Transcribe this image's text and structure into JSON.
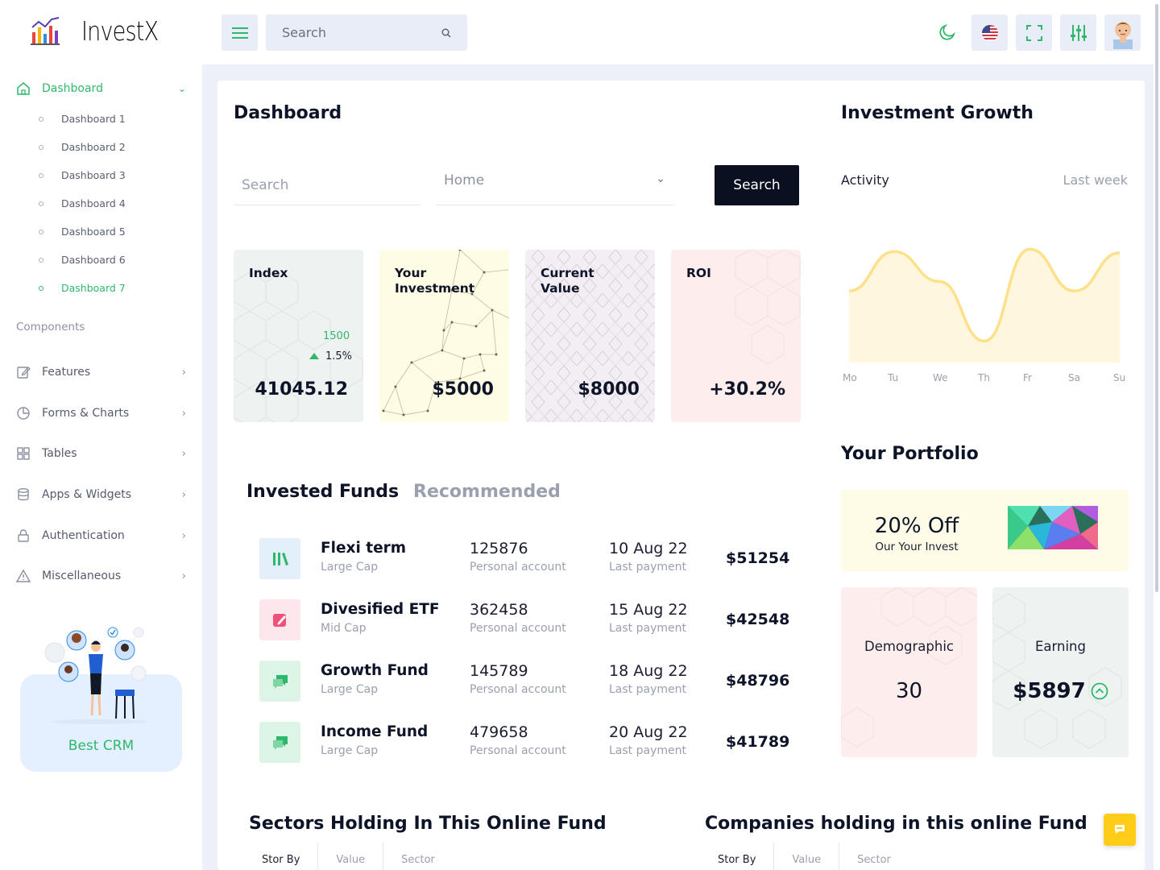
{
  "brand": {
    "name": "InvestX"
  },
  "sidebar": {
    "dashboard_label": "Dashboard",
    "sub_items": [
      "Dashboard 1",
      "Dashboard 2",
      "Dashboard 3",
      "Dashboard 4",
      "Dashboard 5",
      "Dashboard 6",
      "Dashboard 7"
    ],
    "active_sub_item": "Dashboard 7",
    "components_heading": "Components",
    "groups": [
      {
        "label": "Features",
        "icon": "edit-icon"
      },
      {
        "label": "Forms & Charts",
        "icon": "pie-chart-icon"
      },
      {
        "label": "Tables",
        "icon": "grid-icon"
      },
      {
        "label": "Apps & Widgets",
        "icon": "database-icon"
      },
      {
        "label": "Authentication",
        "icon": "lock-icon"
      },
      {
        "label": "Miscellaneous",
        "icon": "alert-triangle-icon"
      }
    ],
    "promo_label": "Best CRM"
  },
  "topbar": {
    "search_placeholder": "Search",
    "icons": [
      "menu-icon",
      "search-icon",
      "moon-icon",
      "us-flag-icon",
      "fullscreen-icon",
      "settings-sliders-icon",
      "user-avatar"
    ]
  },
  "dashboard": {
    "title": "Dashboard",
    "filter_search_placeholder": "Search",
    "filter_select_value": "Home",
    "filter_button": "Search",
    "stats": [
      {
        "label": "Index",
        "value": "41045.12",
        "extra_value": "1500",
        "change": "1.5%",
        "color": "#eef2f1"
      },
      {
        "label": "Your Investment",
        "value": "$5000",
        "color": "#fefce4"
      },
      {
        "label": "Current Value",
        "value": "$8000",
        "color": "#f2eef4"
      },
      {
        "label": "ROI",
        "value": "+30.2%",
        "color": "#fdeeed"
      }
    ],
    "tabs": [
      "Invested Funds",
      "Recommended"
    ],
    "funds": [
      {
        "name": "Flexi term",
        "category": "Large Cap",
        "account_no": "125876",
        "account_type": "Personal account",
        "date": "10 Aug 22",
        "date_label": "Last payment",
        "amount": "$51254",
        "icon": "library-icon",
        "icon_bg": "#e4effc",
        "icon_color": "#2fb86c"
      },
      {
        "name": "Divesified ETF",
        "category": "Mid Cap",
        "account_no": "362458",
        "account_type": "Personal account",
        "date": "15 Aug 22",
        "date_label": "Last payment",
        "amount": "$42548",
        "icon": "edit-box-icon",
        "icon_bg": "#fde7ec",
        "icon_color": "#f0517a"
      },
      {
        "name": "Growth Fund",
        "category": "Large Cap",
        "account_no": "145789",
        "account_type": "Personal account",
        "date": "18 Aug 22",
        "date_label": "Last payment",
        "amount": "$48796",
        "icon": "chat-icon",
        "icon_bg": "#dcf5e6",
        "icon_color": "#2fb86c"
      },
      {
        "name": "Income Fund",
        "category": "Large Cap",
        "account_no": "479658",
        "account_type": "Personal account",
        "date": "20 Aug 22",
        "date_label": "Last payment",
        "amount": "$41789",
        "icon": "chat-icon",
        "icon_bg": "#dcf5e6",
        "icon_color": "#2fb86c"
      }
    ],
    "sectors_title": "Sectors Holding In This Online Fund",
    "companies_title": "Companies holding in this online Fund",
    "sort_labels": [
      "Stor By",
      "Value",
      "Sector"
    ]
  },
  "growth": {
    "title": "Investment Growth",
    "activity_label": "Activity",
    "period_label": "Last week"
  },
  "chart_data": {
    "type": "area",
    "x": [
      "Mo",
      "Tu",
      "We",
      "Th",
      "Fr",
      "Sa",
      "Su"
    ],
    "values": [
      60,
      93,
      68,
      18,
      95,
      60,
      92
    ],
    "ylim": [
      0,
      100
    ],
    "grid": false,
    "line_color": "#fde08a",
    "fill_color": "#fff7dd"
  },
  "portfolio": {
    "title": "Your Portfolio",
    "promo_big": "20% Off",
    "promo_small": "Our Your Invest",
    "demographic_label": "Demographic",
    "demographic_value": "30",
    "earning_label": "Earning",
    "earning_value": "$5897",
    "demographic_color": "#fdeeed",
    "earning_color": "#eef2f1"
  },
  "colors": {
    "accent": "#2fb86c",
    "dark": "#0b1020",
    "fab": "#ffcd17"
  }
}
